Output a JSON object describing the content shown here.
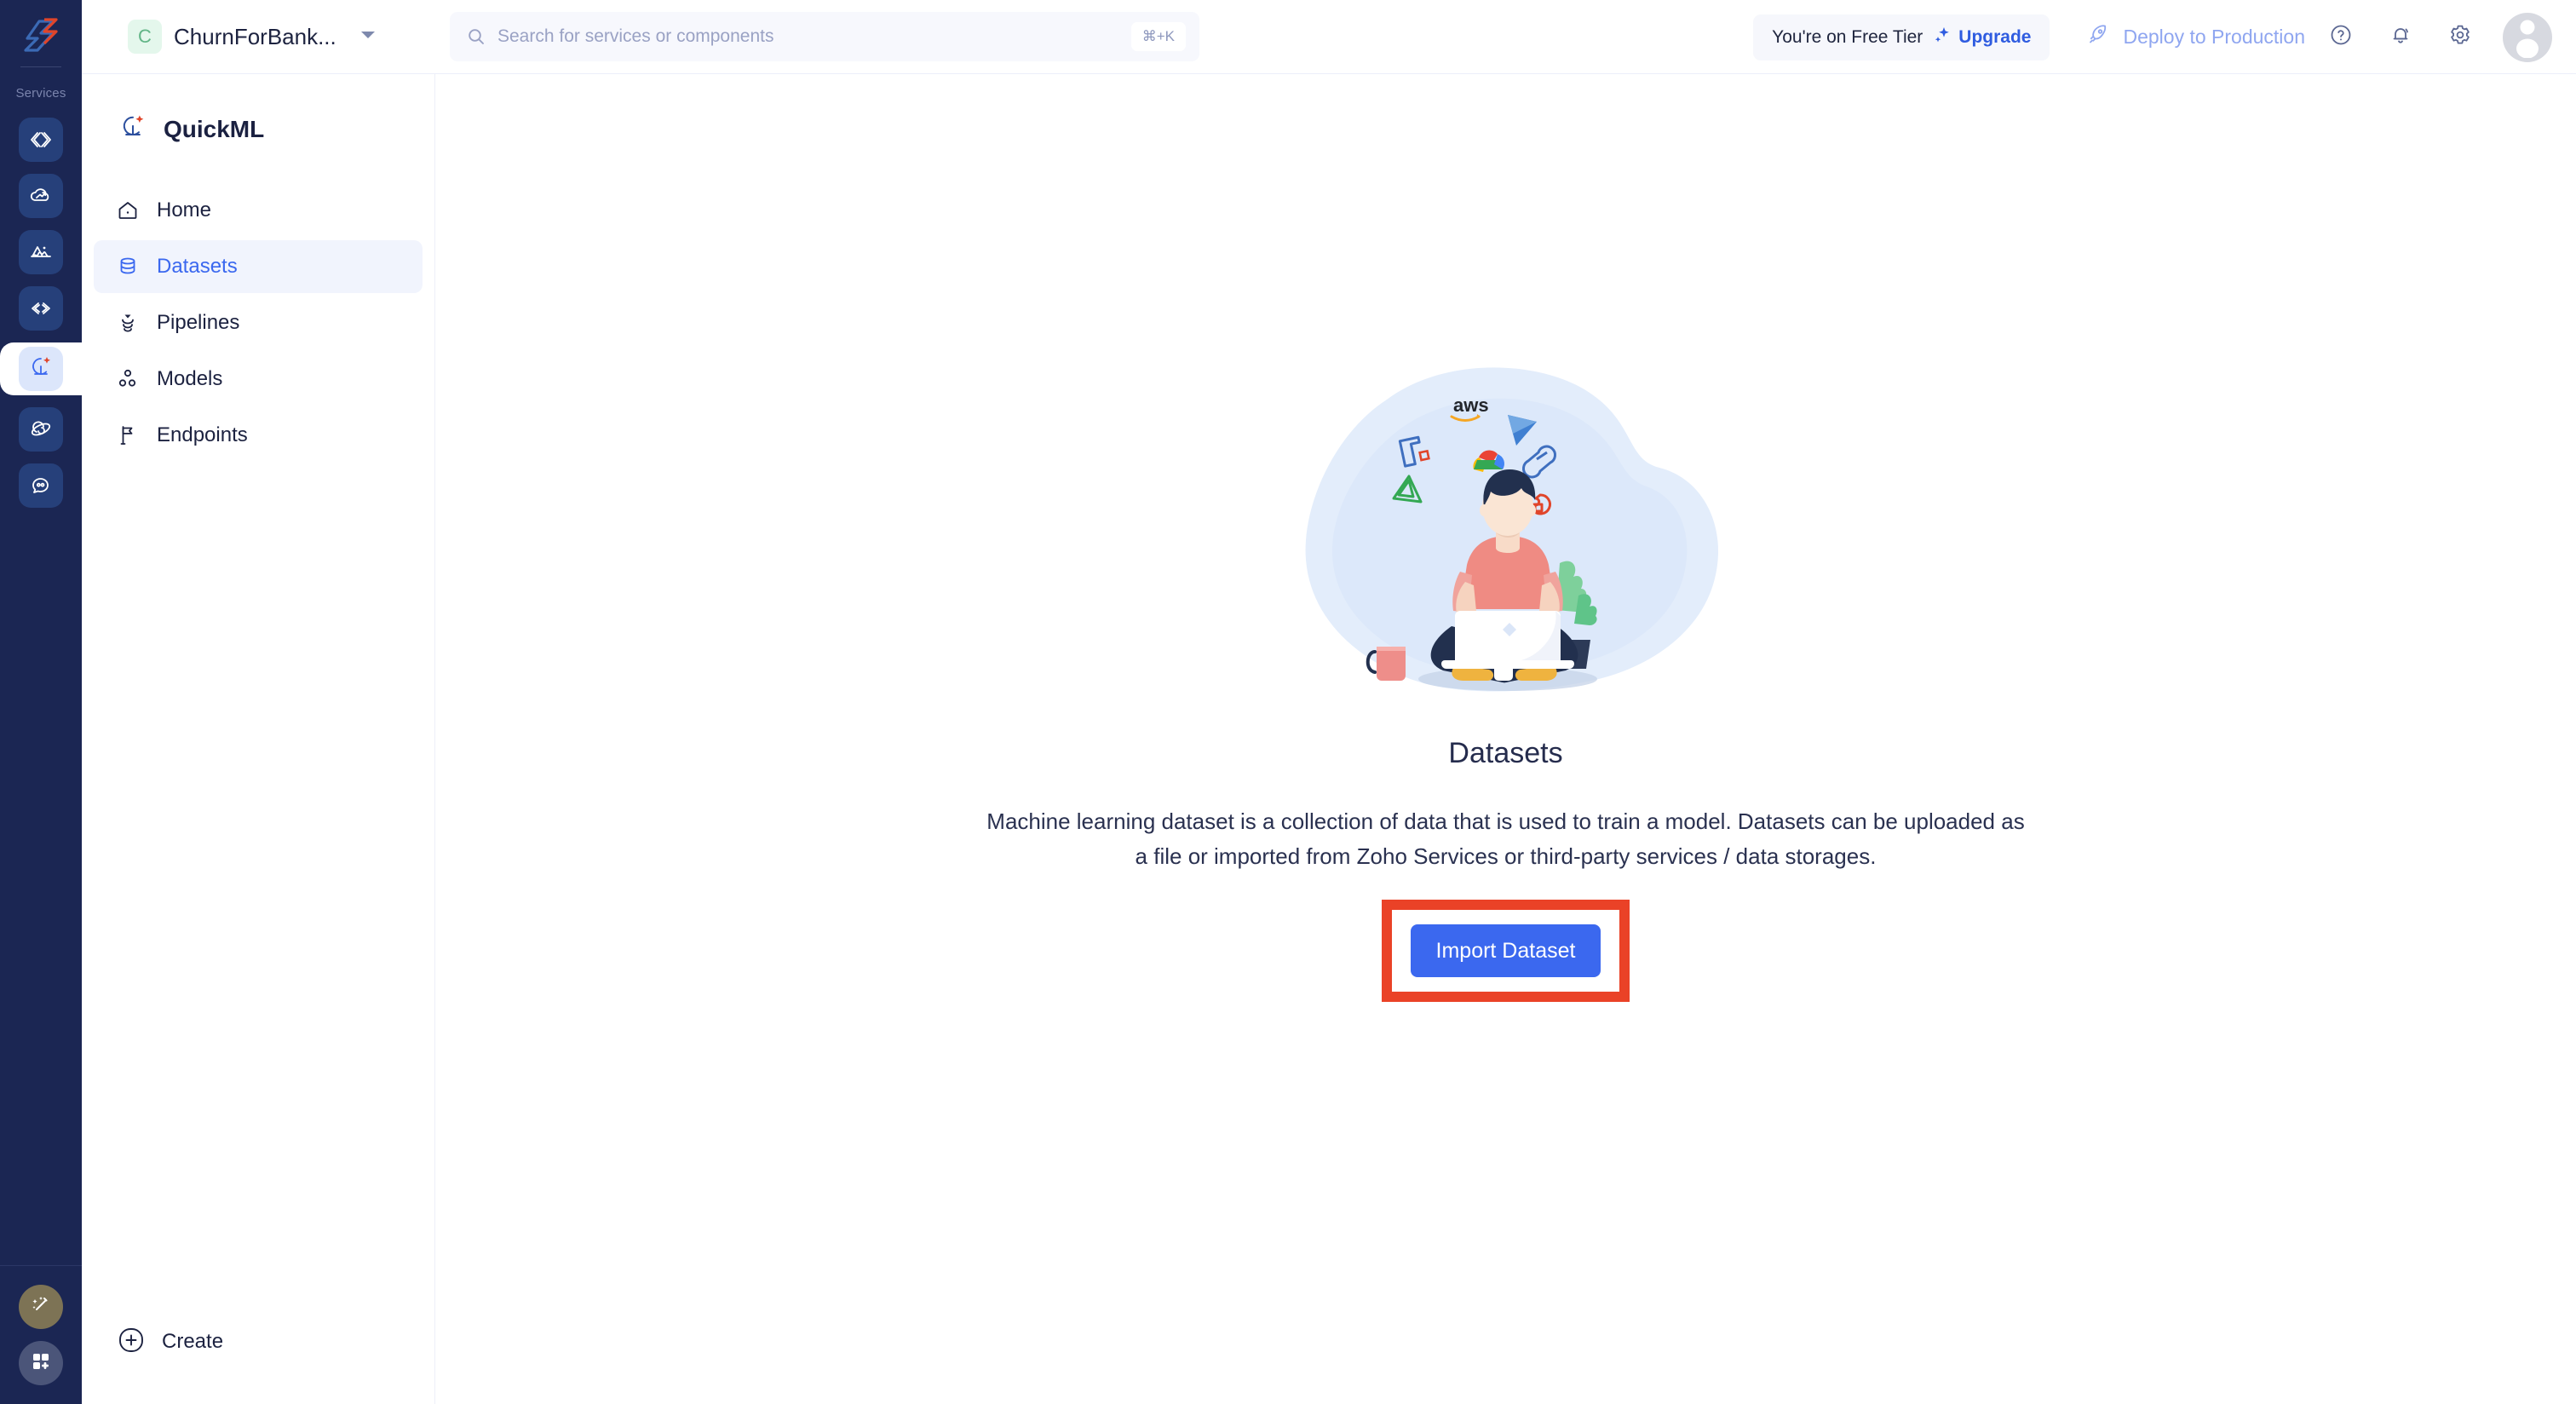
{
  "rail": {
    "logo_icon": "zoho-catalyst-logo-icon",
    "section_label": "Services",
    "items": [
      {
        "name": "code-service",
        "icon": "code-brackets-icon"
      },
      {
        "name": "cloud-scale-service",
        "icon": "cloud-arrow-icon"
      },
      {
        "name": "data-service",
        "icon": "data-waves-icon"
      },
      {
        "name": "connect-service",
        "icon": "link-arrows-icon"
      },
      {
        "name": "quickml-service",
        "icon": "quickml-sparkle-icon",
        "active": true
      },
      {
        "name": "orbit-service",
        "icon": "orbit-icon"
      },
      {
        "name": "chat-service",
        "icon": "chat-bubble-icon"
      }
    ],
    "bottom_items": [
      {
        "name": "ai-assistant",
        "icon": "magic-wand-icon"
      },
      {
        "name": "app-launcher",
        "icon": "grid-plus-icon"
      }
    ]
  },
  "topbar": {
    "project": {
      "initial": "C",
      "name": "ChurnForBank...",
      "caret_icon": "chevron-down-icon"
    },
    "search": {
      "icon": "search-icon",
      "placeholder": "Search for services or components",
      "value": "",
      "shortcut": "⌘+K"
    },
    "tier": {
      "text": "You're on Free Tier",
      "upgrade_label": "Upgrade",
      "upgrade_icon": "sparkle-icon"
    },
    "deploy": {
      "label": "Deploy to Production",
      "icon": "rocket-icon"
    },
    "actions": [
      {
        "name": "help-button",
        "icon": "question-circle-icon"
      },
      {
        "name": "notifications-button",
        "icon": "bell-icon"
      },
      {
        "name": "settings-button",
        "icon": "gear-icon"
      }
    ],
    "avatar": {
      "icon": "user-avatar-icon"
    }
  },
  "sidebar": {
    "brand": {
      "label": "QuickML",
      "icon": "quickml-sparkle-icon"
    },
    "items": [
      {
        "label": "Home",
        "icon": "home-icon",
        "active": false
      },
      {
        "label": "Datasets",
        "icon": "database-icon",
        "active": true
      },
      {
        "label": "Pipelines",
        "icon": "pipeline-funnel-icon",
        "active": false
      },
      {
        "label": "Models",
        "icon": "models-nodes-icon",
        "active": false
      },
      {
        "label": "Endpoints",
        "icon": "flag-icon",
        "active": false
      }
    ],
    "create": {
      "label": "Create",
      "icon": "plus-circle-icon"
    }
  },
  "main": {
    "illustration": {
      "name": "person-with-laptop-illustration",
      "service_logos": [
        "aws",
        "zoho-analytics",
        "zoho-creator",
        "google-cloud",
        "zoho-crm",
        "azure",
        "zoho-desk"
      ]
    },
    "title": "Datasets",
    "description": "Machine learning dataset is a collection of data that is used to train a model. Datasets can be uploaded as a file or imported from Zoho Services or third-party services / data storages.",
    "import_button": {
      "label": "Import Dataset"
    },
    "highlight": {
      "color": "#ea4227"
    }
  },
  "colors": {
    "rail_bg": "#1b2653",
    "accent_blue": "#3b68ef",
    "link_blue": "#2f5ce0",
    "deploy_blue": "#8fa6f0",
    "highlight_red": "#ea4227",
    "active_nav_bg": "#f1f4fd"
  }
}
